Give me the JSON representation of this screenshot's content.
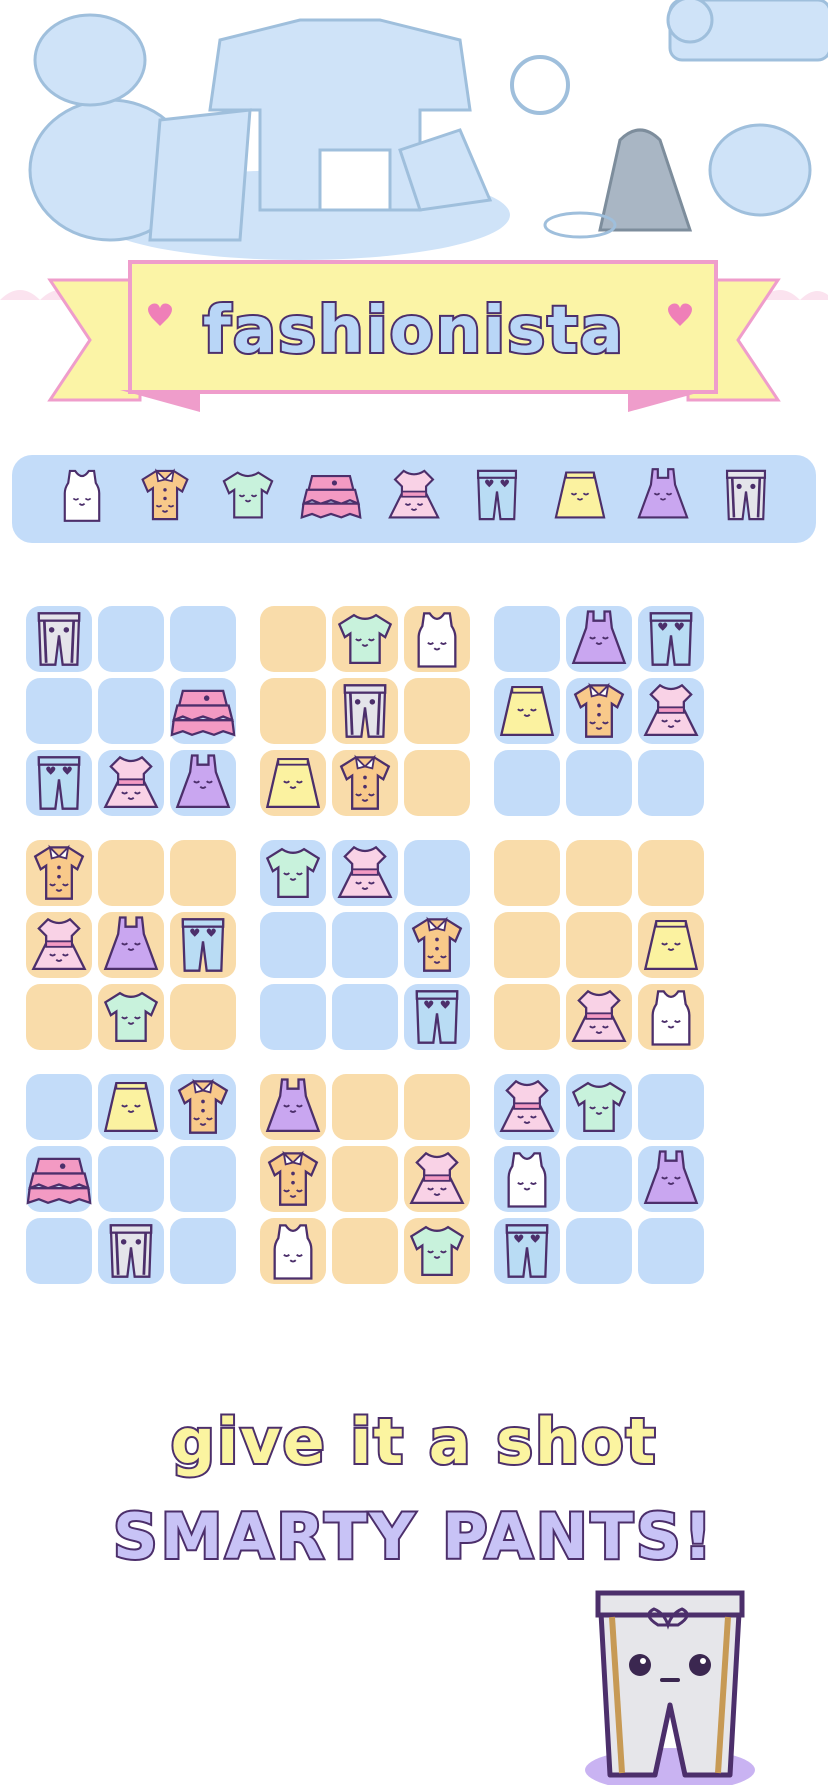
{
  "title": "fashionista",
  "slogan": {
    "line1": "give it a shot",
    "line2": "SMARTY PANTS!"
  },
  "colors": {
    "zone_blue": "#c3dcf9",
    "zone_orange": "#f9dcaa",
    "banner_fill": "#fbf4a6",
    "banner_border": "#ef9dcb",
    "outline": "#4c2f6b"
  },
  "pieces": [
    "white-tank-top",
    "orange-collar-shirt",
    "mint-tshirt",
    "pink-ruffle-skirt",
    "pink-dress",
    "blue-jeans",
    "yellow-skirt",
    "purple-dress",
    "gray-track-pants"
  ],
  "board": [
    [
      "gray-track-pants",
      "",
      "",
      "",
      "mint-tshirt",
      "white-tank-top",
      "",
      "purple-dress",
      "blue-jeans"
    ],
    [
      "",
      "",
      "pink-ruffle-skirt",
      "",
      "gray-track-pants",
      "",
      "yellow-skirt",
      "orange-collar-shirt",
      "pink-dress"
    ],
    [
      "blue-jeans",
      "pink-dress",
      "purple-dress",
      "yellow-skirt",
      "orange-collar-shirt",
      "",
      "",
      "",
      ""
    ],
    [
      "orange-collar-shirt",
      "",
      "",
      "mint-tshirt",
      "pink-dress",
      "",
      "",
      "",
      ""
    ],
    [
      "pink-dress",
      "purple-dress",
      "blue-jeans",
      "",
      "",
      "orange-collar-shirt",
      "",
      "",
      "yellow-skirt"
    ],
    [
      "",
      "mint-tshirt",
      "",
      "",
      "",
      "blue-jeans",
      "",
      "pink-dress",
      "white-tank-top"
    ],
    [
      "",
      "yellow-skirt",
      "orange-collar-shirt",
      "purple-dress",
      "",
      "",
      "pink-dress",
      "mint-tshirt",
      ""
    ],
    [
      "pink-ruffle-skirt",
      "",
      "",
      "orange-collar-shirt",
      "",
      "pink-dress",
      "white-tank-top",
      "",
      "purple-dress"
    ],
    [
      "",
      "gray-track-pants",
      "",
      "white-tank-top",
      "",
      "mint-tshirt",
      "blue-jeans",
      "",
      ""
    ]
  ]
}
